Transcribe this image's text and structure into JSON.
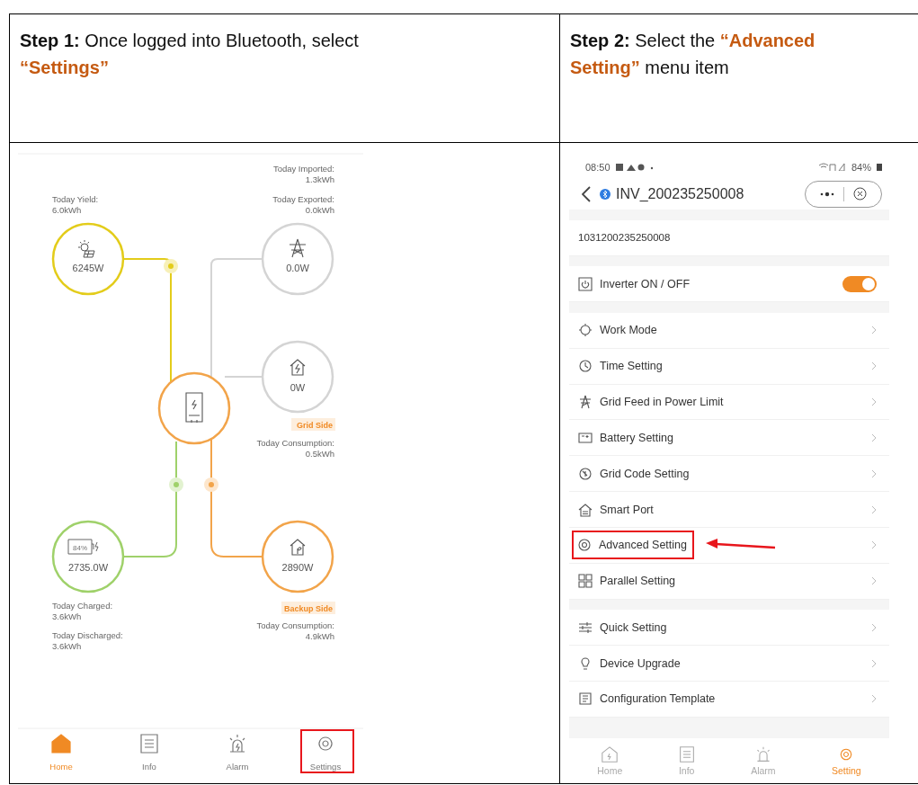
{
  "steps": [
    {
      "label": "Step 1:",
      "text": "Once logged into Bluetooth, select ",
      "highlight": "“Settings”"
    },
    {
      "label": "Step 2:",
      "text": "Select the ",
      "highlight": "“Advanced Setting”",
      "after": " menu item"
    }
  ],
  "home_screen": {
    "grid_stats": [
      {
        "label": "Today Imported:",
        "value": "1.3kWh"
      },
      {
        "label": "Today Exported:",
        "value": "0.0kWh"
      }
    ],
    "solar": {
      "label": "Today Yield:",
      "value": "6.0kWh",
      "power": "6245W"
    },
    "grid": {
      "power": "0.0W"
    },
    "grid_load": {
      "power": "0W",
      "tag": "Grid Side",
      "label": "Today Consumption:",
      "value": "0.5kWh"
    },
    "battery": {
      "power": "2735.0W",
      "charge": "84%",
      "stats": [
        {
          "label": "Today Charged:",
          "value": "3.6kWh"
        },
        {
          "label": "Today Discharged:",
          "value": "3.6kWh"
        }
      ]
    },
    "backup_load": {
      "power": "2890W",
      "tag": "Backup Side",
      "label": "Today Consumption:",
      "value": "4.9kWh"
    },
    "nav": [
      {
        "label": "Home",
        "selected": true,
        "highlighted": false
      },
      {
        "label": "Info",
        "selected": false,
        "highlighted": false
      },
      {
        "label": "Alarm",
        "selected": false,
        "highlighted": false
      },
      {
        "label": "Settings",
        "selected": false,
        "highlighted": true
      }
    ]
  },
  "settings_screen": {
    "time": "08:50",
    "battery": "84%",
    "title": "INV_200235250008",
    "serial": "1031200235250008",
    "toggle": {
      "label": "Inverter ON / OFF",
      "on": true
    },
    "groups": [
      [
        {
          "label": "Work Mode",
          "highlighted": false
        },
        {
          "label": "Time Setting",
          "highlighted": false
        },
        {
          "label": "Grid Feed in Power Limit",
          "highlighted": false
        },
        {
          "label": "Battery Setting",
          "highlighted": false
        },
        {
          "label": "Grid Code Setting",
          "highlighted": false
        },
        {
          "label": "Smart Port",
          "highlighted": false
        },
        {
          "label": "Advanced Setting",
          "highlighted": true
        },
        {
          "label": "Parallel Setting",
          "highlighted": false
        }
      ],
      [
        {
          "label": "Quick Setting",
          "highlighted": false
        },
        {
          "label": "Device Upgrade",
          "highlighted": false
        },
        {
          "label": "Configuration Template",
          "highlighted": false
        }
      ]
    ],
    "nav": [
      {
        "label": "Home",
        "selected": false
      },
      {
        "label": "Info",
        "selected": false
      },
      {
        "label": "Alarm",
        "selected": false
      },
      {
        "label": "Setting",
        "selected": true
      }
    ]
  }
}
